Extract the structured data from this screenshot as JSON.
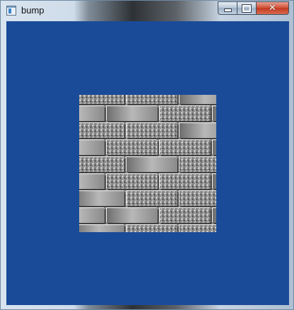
{
  "window": {
    "title": "bump",
    "icon": "app-window-icon",
    "controls": {
      "minimize_icon": "minimize-icon",
      "maximize_icon": "maximize-icon",
      "close_icon": "close-icon"
    }
  },
  "viewport": {
    "clear_color": "#1a4b99",
    "texture": "brick-bump-texture"
  }
}
